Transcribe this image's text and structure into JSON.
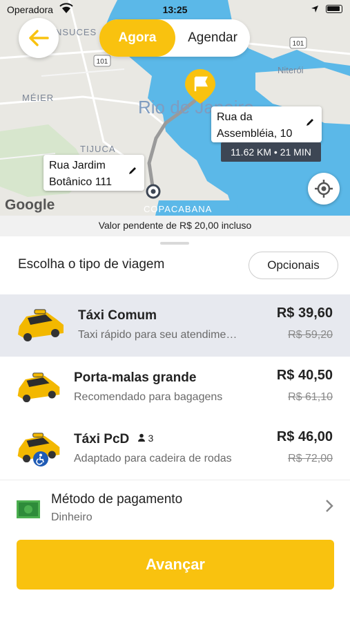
{
  "status_bar": {
    "carrier": "Operadora",
    "time": "13:25"
  },
  "header": {
    "toggle": {
      "active": "Agora",
      "inactive": "Agendar"
    }
  },
  "map": {
    "city_label": "Rio de Janeiro",
    "districts": [
      "NSUCES",
      "MÉIER",
      "TIJUCA",
      "COPACABANA",
      "Niterói"
    ],
    "roads": [
      "101",
      "101"
    ],
    "destination": {
      "line1": "Rua da",
      "line2": "Assembléia, 10"
    },
    "origin": {
      "line1": "Rua Jardim",
      "line2": "Botânico 111"
    },
    "eta": "11.62 KM • 21 MIN",
    "google_logo": "Google"
  },
  "pending_note": "Valor pendente de R$ 20,00 incluso",
  "trip_section": {
    "title": "Escolha o tipo de viagem",
    "optional_button": "Opcionais"
  },
  "rides": [
    {
      "name": "Táxi Comum",
      "description": "Taxi rápido para seu atendime…",
      "price": "R$ 39,60",
      "old_price": "R$ 59,20",
      "selected": true
    },
    {
      "name": "Porta-malas grande",
      "description": "Recomendado para bagagens",
      "price": "R$ 40,50",
      "old_price": "R$ 61,10",
      "selected": false
    },
    {
      "name": "Táxi PcD",
      "seats": "3",
      "description": "Adaptado para cadeira de rodas",
      "price": "R$ 46,00",
      "old_price": "R$ 72,00",
      "selected": false
    }
  ],
  "payment": {
    "label": "Método de pagamento",
    "method": "Dinheiro"
  },
  "advance_button": "Avançar",
  "colors": {
    "accent": "#f9c20f",
    "water": "#5bb8e8",
    "selected_row": "#e7e9ef",
    "eta_bg": "#3d4654"
  }
}
